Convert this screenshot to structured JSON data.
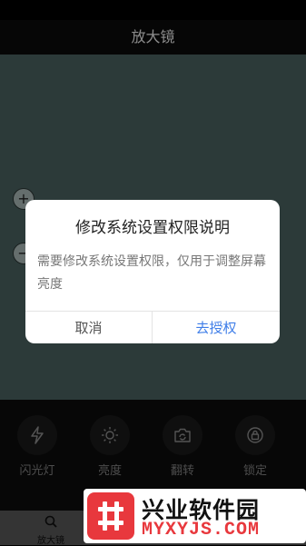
{
  "header": {
    "title": "放大镜"
  },
  "zoom": {
    "in_symbol": "+",
    "out_symbol": "−"
  },
  "controls": [
    {
      "label": "闪光灯",
      "icon": "flash-icon"
    },
    {
      "label": "亮度",
      "icon": "brightness-icon"
    },
    {
      "label": "翻转",
      "icon": "flip-camera-icon"
    },
    {
      "label": "锁定",
      "icon": "lock-icon"
    }
  ],
  "bottom_nav": {
    "label": "放大镜",
    "icon": "magnifier-icon"
  },
  "dialog": {
    "title": "修改系统设置权限说明",
    "message": "需要修改系统设置权限，仅用于调整屏幕亮度",
    "cancel_label": "取消",
    "confirm_label": "去授权"
  },
  "watermark": {
    "name": "兴业软件园",
    "domain": "MYXYJS.COM"
  },
  "colors": {
    "camera_bg": "#506a69",
    "accent_blue": "#3e7de8",
    "watermark_red": "#e8383d"
  }
}
